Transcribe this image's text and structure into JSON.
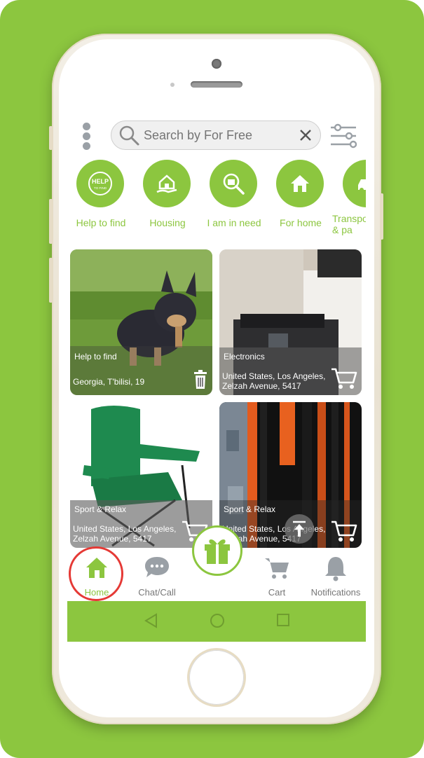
{
  "colors": {
    "accent": "#8cc63f",
    "nav_inactive": "#9aa0a6",
    "highlight_ring": "#e53935"
  },
  "search": {
    "placeholder": "Search by For Free"
  },
  "categories": [
    {
      "label": "Help to find",
      "icon": "help-badge-icon",
      "badge_text": "HELP",
      "badge_sub": "TO FIND"
    },
    {
      "label": "Housing",
      "icon": "house-hand-icon"
    },
    {
      "label": "I am in need",
      "icon": "magnifier-bag-icon"
    },
    {
      "label": "For home",
      "icon": "home-icon"
    },
    {
      "label": "Transpo\n& pa",
      "icon": "car-icon"
    }
  ],
  "listings": [
    {
      "category": "Help to find",
      "location": "Georgia, T'bilisi, 19",
      "action_icon": "trash-icon",
      "image": "french-bulldog-on-grass"
    },
    {
      "category": "Electronics",
      "location": "United States, Los Angeles, Zelzah Avenue, 5417",
      "action_icon": "cart-icon",
      "image": "printer-on-desk"
    },
    {
      "category": "Sport & Relax",
      "location": "United States, Los Angeles, Zelzah Avenue, 5417",
      "action_icon": "cart-icon",
      "image": "green-folding-chair"
    },
    {
      "category": "Sport & Relax",
      "location": "United States, Los Angeles, Zelzah Avenue, 5417",
      "action_icon": "cart-icon",
      "image": "skis"
    }
  ],
  "nav": {
    "home": "Home",
    "chat": "Chat/Call",
    "cart": "Cart",
    "notifications": "Notifications",
    "active": "Home"
  }
}
